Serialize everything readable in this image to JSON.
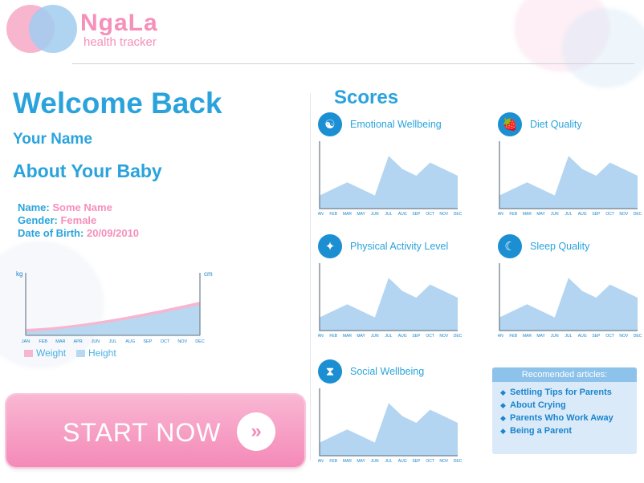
{
  "brand": {
    "name": "NgaLa",
    "tagline": "health tracker"
  },
  "left": {
    "welcome": "Welcome Back",
    "your_name": "Your Name",
    "about_baby": "About Your Baby",
    "info": [
      {
        "label": "Name:",
        "value": "Some Name"
      },
      {
        "label": "Gender:",
        "value": "Female"
      },
      {
        "label": "Date of Birth:",
        "value": "20/09/2010"
      }
    ]
  },
  "growth_chart": {
    "y_left_unit": "kg",
    "y_right_unit": "cm",
    "months": [
      "JAN",
      "FEB",
      "MAR",
      "APR",
      "JUN",
      "JUL",
      "AUG",
      "SEP",
      "OCT",
      "NOV",
      "DEC"
    ],
    "legend": {
      "weight": "Weight",
      "height": "Height"
    },
    "colors": {
      "weight": "#f6b6cf",
      "height": "#b8d7f1"
    }
  },
  "start_button": {
    "label": "START NOW",
    "icon": "double-chevron-right-icon",
    "arrow_glyph": "»"
  },
  "scores": {
    "title": "Scores",
    "months": [
      "JAN",
      "FEB",
      "MAR",
      "MAY",
      "JUN",
      "JUL",
      "AUG",
      "SEP",
      "OCT",
      "NOV",
      "DEC"
    ],
    "cards": [
      {
        "title": "Emotional Wellbeing",
        "icon": "meditation-icon",
        "glyph": "☯"
      },
      {
        "title": "Diet Quality",
        "icon": "fruit-icon",
        "glyph": "🍓"
      },
      {
        "title": "Physical Activity Level",
        "icon": "activity-icon",
        "glyph": "✦"
      },
      {
        "title": "Sleep Quality",
        "icon": "moon-icon",
        "glyph": "☾"
      },
      {
        "title": "Social Wellbeing",
        "icon": "hourglass-icon",
        "glyph": "⧗"
      }
    ],
    "area_color": "#b3d5f1"
  },
  "chart_data": {
    "type": "area",
    "note_series": "All five score charts show the same relative profile (no y-axis scale printed).",
    "categories": [
      "JAN",
      "FEB",
      "MAR",
      "MAY",
      "JUN",
      "JUL",
      "AUG",
      "SEP",
      "OCT",
      "NOV",
      "DEC"
    ],
    "series": [
      {
        "name": "Emotional Wellbeing",
        "values": [
          20,
          30,
          40,
          30,
          20,
          80,
          60,
          50,
          70,
          60,
          50
        ]
      },
      {
        "name": "Diet Quality",
        "values": [
          20,
          30,
          40,
          30,
          20,
          80,
          60,
          50,
          70,
          60,
          50
        ]
      },
      {
        "name": "Physical Activity Level",
        "values": [
          20,
          30,
          40,
          30,
          20,
          80,
          60,
          50,
          70,
          60,
          50
        ]
      },
      {
        "name": "Sleep Quality",
        "values": [
          20,
          30,
          40,
          30,
          20,
          80,
          60,
          50,
          70,
          60,
          50
        ]
      },
      {
        "name": "Social Wellbeing",
        "values": [
          20,
          30,
          40,
          30,
          20,
          80,
          60,
          50,
          70,
          60,
          50
        ]
      }
    ]
  },
  "articles": {
    "header": "Recomended articles:",
    "items": [
      "Settling Tips for Parents",
      "About Crying",
      "Parents Who Work Away",
      "Being a Parent"
    ]
  }
}
